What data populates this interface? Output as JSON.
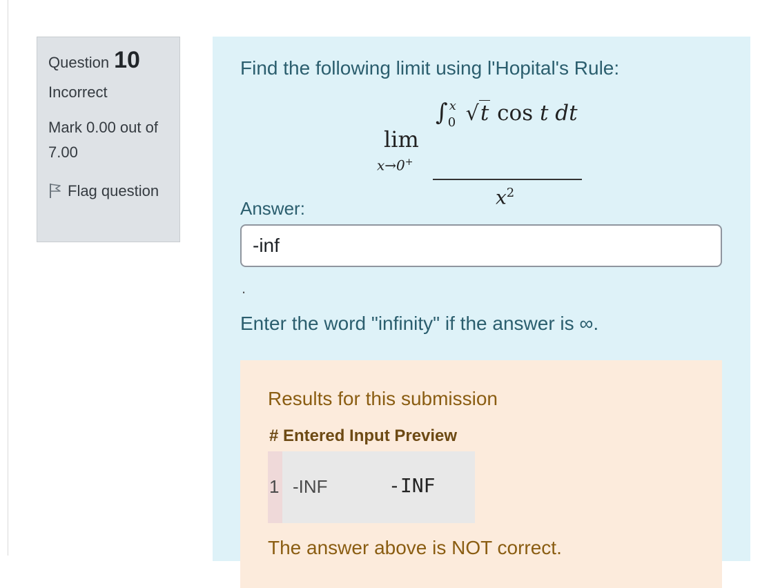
{
  "question": {
    "label": "Question",
    "number": "10",
    "state": "Incorrect",
    "grade": "Mark 0.00 out of 7.00",
    "flag_label": "Flag question"
  },
  "content": {
    "prompt": "Find the following limit using l'Hopital's Rule:",
    "math": {
      "lim": "lim",
      "subscript_var": "x→0",
      "subscript_sup": "+",
      "integral": "∫",
      "upper": "x",
      "lower": "0",
      "radicand": "t",
      "cos": "cos",
      "t_var": "t",
      "dt": "dt",
      "den_base": "x",
      "den_exp": "2"
    },
    "answer_label": "Answer:",
    "answer_value": "-inf",
    "dot": ".",
    "hint": "Enter the word \"infinity\" if the answer is ∞."
  },
  "feedback": {
    "title": "Results for this submission",
    "header": "# Entered Input Preview",
    "row_number": "1",
    "entered": "-INF",
    "preview": "-INF",
    "verdict": "The answer above is NOT correct."
  },
  "colors": {
    "info_bg": "#dee2e6",
    "content_bg": "#def2f8",
    "feedback_bg": "#fcebdc",
    "content_text": "#2b5e6e",
    "feedback_text": "#8a5d12"
  }
}
